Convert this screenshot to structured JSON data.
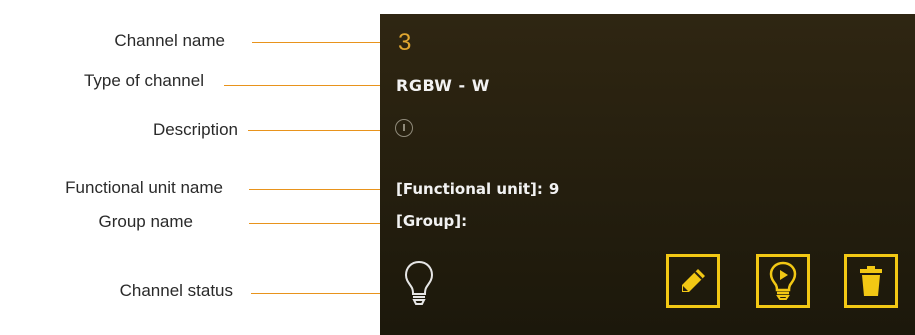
{
  "callouts": {
    "channel_name": "Channel name",
    "type_of_channel": "Type of channel",
    "description": "Description",
    "functional_unit_name": "Functional unit name",
    "group_name": "Group name",
    "channel_status": "Channel status"
  },
  "channel": {
    "name": "3",
    "type": "RGBW - W",
    "functional_unit_label": "[Functional unit]:",
    "functional_unit_value": "9",
    "group_label": "[Group]:",
    "group_value": "",
    "status_icon": "lightbulb-icon"
  },
  "actions": {
    "edit_icon": "pencil-icon",
    "play_icon": "bulb-play-icon",
    "delete_icon": "trash-icon"
  },
  "colors": {
    "accent_orange": "#e8931c",
    "accent_yellow": "#f2c814",
    "panel_bg": "#2a2311",
    "text_light": "#f2f2f2"
  }
}
